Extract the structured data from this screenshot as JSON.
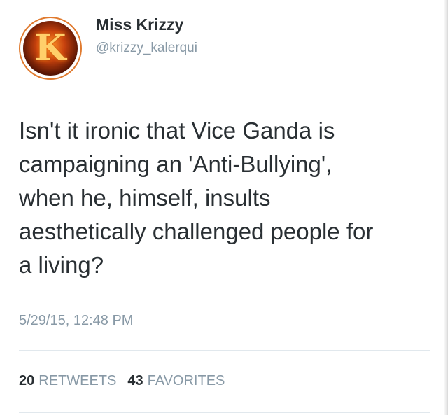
{
  "user": {
    "display_name": "Miss Krizzy",
    "handle": "@krizzy_kalerqui",
    "avatar_letter": "K"
  },
  "tweet": {
    "text": "Isn't it ironic that Vice Ganda is\ncampaigning an 'Anti-Bullying',\nwhen he, himself, insults\naesthetically challenged people for\na living?",
    "timestamp": "5/29/15, 12:48 PM"
  },
  "stats": {
    "retweets_count": "20",
    "retweets_label": "RETWEETS",
    "favorites_count": "43",
    "favorites_label": "FAVORITES"
  },
  "colors": {
    "text_primary": "#292f33",
    "text_secondary": "#8899a6",
    "divider": "#e1e8ed",
    "avatar_ring": "#e07a2e"
  }
}
